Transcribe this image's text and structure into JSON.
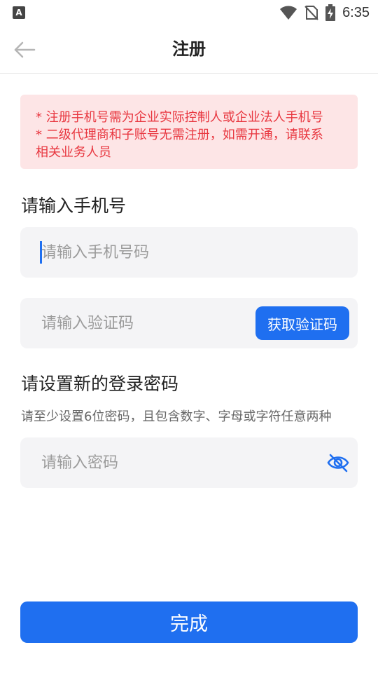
{
  "status_bar": {
    "left_icon_letter": "A",
    "time": "6:35",
    "icons": [
      "wifi-icon",
      "no-sim-icon",
      "battery-charging-icon"
    ]
  },
  "nav": {
    "title": "注册",
    "back_icon": "arrow-left-icon"
  },
  "notice": {
    "lines": [
      "* 注册手机号需为企业实际控制人或企业法人手机号",
      "* 二级代理商和子账号无需注册，如需开通，请联系",
      "相关业务人员"
    ],
    "color": "#e8363f",
    "background": "#fde5e6"
  },
  "phone_section": {
    "title": "请输入手机号",
    "phone_placeholder": "请输入手机号码",
    "phone_value": "",
    "code_placeholder": "请输入验证码",
    "code_value": "",
    "get_code_label": "获取验证码"
  },
  "password_section": {
    "title": "请设置新的登录密码",
    "hint": "请至少设置6位密码，且包含数字、字母或字符任意两种",
    "password_placeholder": "请输入密码",
    "password_value": "",
    "visibility_icon": "eye-off-icon"
  },
  "submit_label": "完成",
  "colors": {
    "accent": "#1f6ff0",
    "field_background": "#f4f4f6"
  }
}
